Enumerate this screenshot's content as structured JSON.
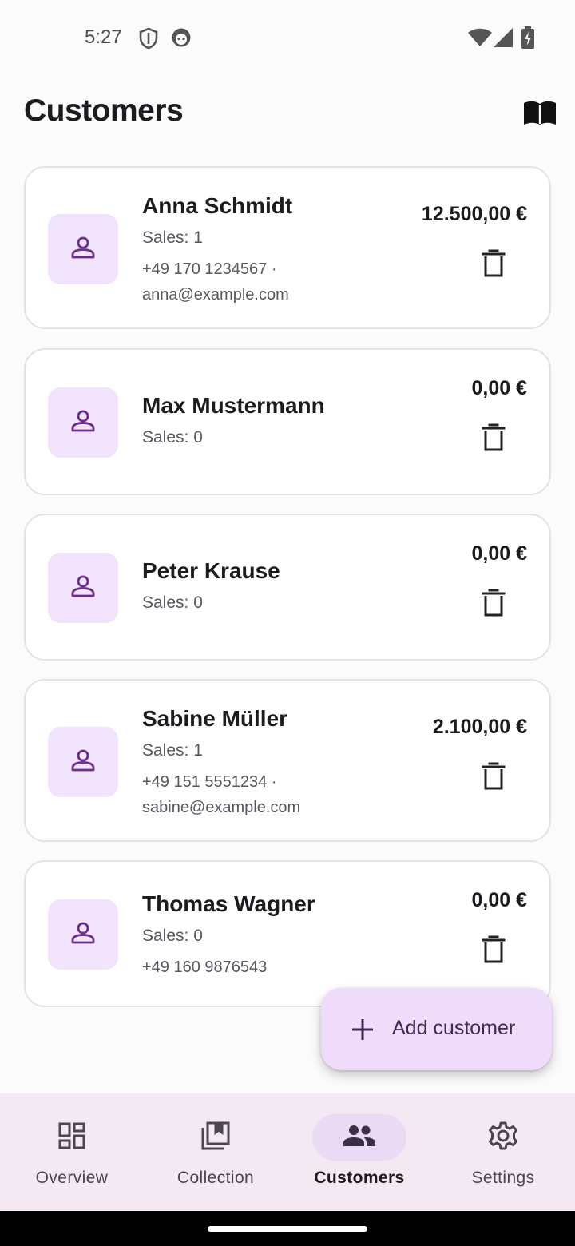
{
  "status_bar": {
    "time": "5:27",
    "icons": [
      "shield-icon",
      "face-icon",
      "wifi-icon",
      "signal-icon",
      "battery-charging-icon"
    ]
  },
  "header": {
    "title": "Customers",
    "action_icon": "book-icon"
  },
  "customers": [
    {
      "name": "Anna Schmidt",
      "sales": "Sales: 1",
      "contact_line1": "+49 170 1234567 ·",
      "contact_line2": "anna@example.com",
      "amount": "12.500,00 €"
    },
    {
      "name": "Max Mustermann",
      "sales": "Sales: 0",
      "amount": "0,00 €"
    },
    {
      "name": "Peter Krause",
      "sales": "Sales: 0",
      "amount": "0,00 €"
    },
    {
      "name": "Sabine Müller",
      "sales": "Sales: 1",
      "contact_line1": "+49 151 5551234 ·",
      "contact_line2": "sabine@example.com",
      "amount": "2.100,00 €"
    },
    {
      "name": "Thomas Wagner",
      "sales": "Sales: 0",
      "contact_line1": "+49 160 9876543",
      "amount": "0,00 €"
    }
  ],
  "fab": {
    "label": "Add customer",
    "icon": "plus-icon"
  },
  "bottom_nav": {
    "active": "Customers",
    "items": [
      {
        "label": "Overview",
        "icon": "dashboard-icon"
      },
      {
        "label": "Collection",
        "icon": "collections-bookmark-icon"
      },
      {
        "label": "Customers",
        "icon": "people-icon"
      },
      {
        "label": "Settings",
        "icon": "gear-icon"
      }
    ]
  },
  "colors": {
    "accent": "#6b2c8c",
    "avatar_bg": "#f1e3fb",
    "fab_bg": "#efdcfa",
    "nav_bg": "#f3e9f3",
    "nav_active_pill": "#eadaf4"
  }
}
